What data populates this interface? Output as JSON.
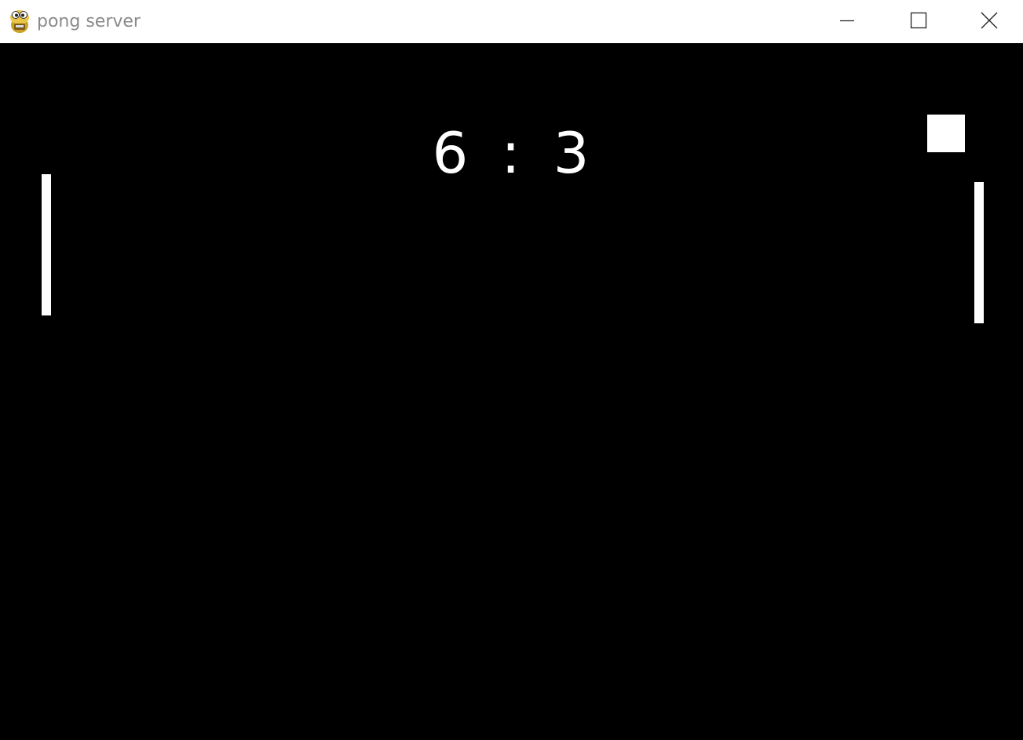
{
  "window": {
    "title": "pong server",
    "icon": "pygame-snake-icon",
    "controls": {
      "minimize": "minimize-icon",
      "maximize": "maximize-icon",
      "close": "close-icon"
    }
  },
  "game": {
    "background_color": "#000000",
    "foreground_color": "#ffffff",
    "score": {
      "left": "6",
      "separator": ":",
      "right": "3"
    }
  }
}
